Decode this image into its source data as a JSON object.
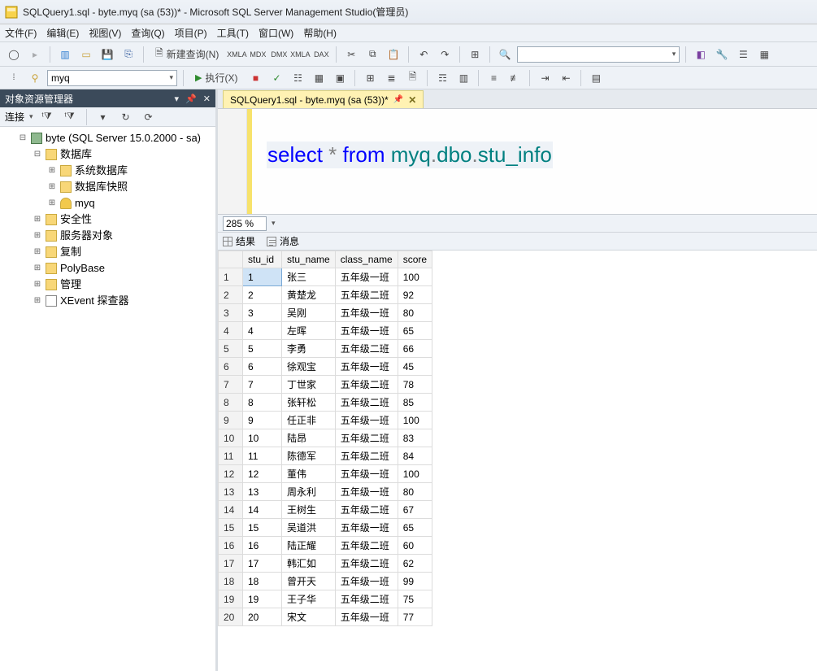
{
  "window": {
    "title": "SQLQuery1.sql - byte.myq (sa (53))* - Microsoft SQL Server Management Studio(管理员)"
  },
  "menu": {
    "file": "文件(F)",
    "edit": "编辑(E)",
    "view": "视图(V)",
    "query": "查询(Q)",
    "project": "项目(P)",
    "tools": "工具(T)",
    "window": "窗口(W)",
    "help": "帮助(H)"
  },
  "toolbar": {
    "new_query": "新建查询(N)",
    "execute": "执行(X)",
    "db_selected": "myq"
  },
  "sidebar": {
    "title": "对象资源管理器",
    "connect": "连接",
    "server": "byte (SQL Server 15.0.2000 - sa)",
    "nodes": {
      "databases": "数据库",
      "sysdb": "系统数据库",
      "snapshot": "数据库快照",
      "userdb": "myq",
      "security": "安全性",
      "serverobj": "服务器对象",
      "replication": "复制",
      "polybase": "PolyBase",
      "management": "管理",
      "xevent": "XEvent 探查器"
    }
  },
  "doc_tab": "SQLQuery1.sql - byte.myq (sa (53))*",
  "sql": {
    "kw1": "select",
    "star": "*",
    "kw2": "from",
    "obj1": "myq",
    "dot": ".",
    "obj2": "dbo",
    "obj3": "stu_info"
  },
  "zoom": "285 %",
  "result_tabs": {
    "results": "结果",
    "messages": "消息"
  },
  "columns": [
    "stu_id",
    "stu_name",
    "class_name",
    "score"
  ],
  "rows": [
    {
      "n": 1,
      "id": "1",
      "name": "张三",
      "class": "五年级一班",
      "score": "100"
    },
    {
      "n": 2,
      "id": "2",
      "name": "黄楚龙",
      "class": "五年级二班",
      "score": "92"
    },
    {
      "n": 3,
      "id": "3",
      "name": "吴刚",
      "class": "五年级一班",
      "score": "80"
    },
    {
      "n": 4,
      "id": "4",
      "name": "左晖",
      "class": "五年级一班",
      "score": "65"
    },
    {
      "n": 5,
      "id": "5",
      "name": "李勇",
      "class": "五年级二班",
      "score": "66"
    },
    {
      "n": 6,
      "id": "6",
      "name": "徐观宝",
      "class": "五年级一班",
      "score": "45"
    },
    {
      "n": 7,
      "id": "7",
      "name": "丁世家",
      "class": "五年级二班",
      "score": "78"
    },
    {
      "n": 8,
      "id": "8",
      "name": "张轩松",
      "class": "五年级二班",
      "score": "85"
    },
    {
      "n": 9,
      "id": "9",
      "name": "任正非",
      "class": "五年级一班",
      "score": "100"
    },
    {
      "n": 10,
      "id": "10",
      "name": "陆昂",
      "class": "五年级二班",
      "score": "83"
    },
    {
      "n": 11,
      "id": "11",
      "name": "陈德军",
      "class": "五年级二班",
      "score": "84"
    },
    {
      "n": 12,
      "id": "12",
      "name": "董伟",
      "class": "五年级一班",
      "score": "100"
    },
    {
      "n": 13,
      "id": "13",
      "name": "周永利",
      "class": "五年级一班",
      "score": "80"
    },
    {
      "n": 14,
      "id": "14",
      "name": "王树生",
      "class": "五年级二班",
      "score": "67"
    },
    {
      "n": 15,
      "id": "15",
      "name": "吴道洪",
      "class": "五年级一班",
      "score": "65"
    },
    {
      "n": 16,
      "id": "16",
      "name": "陆正耀",
      "class": "五年级二班",
      "score": "60"
    },
    {
      "n": 17,
      "id": "17",
      "name": "韩汇如",
      "class": "五年级二班",
      "score": "62"
    },
    {
      "n": 18,
      "id": "18",
      "name": "曾开天",
      "class": "五年级一班",
      "score": "99"
    },
    {
      "n": 19,
      "id": "19",
      "name": "王子华",
      "class": "五年级二班",
      "score": "75"
    },
    {
      "n": 20,
      "id": "20",
      "name": "宋文",
      "class": "五年级一班",
      "score": "77"
    }
  ]
}
